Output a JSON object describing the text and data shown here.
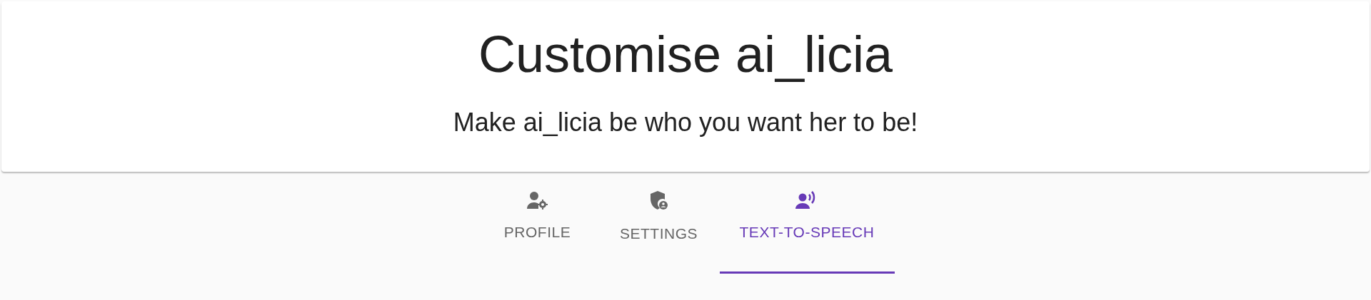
{
  "header": {
    "title": "Customise ai_licia",
    "subtitle": "Make ai_licia be who you want her to be!"
  },
  "tabs": [
    {
      "kind": "profile",
      "label": "PROFILE",
      "selected": false
    },
    {
      "kind": "settings",
      "label": "SETTINGS",
      "selected": false
    },
    {
      "kind": "speech",
      "label": "TEXT-TO-SPEECH",
      "selected": true
    }
  ]
}
